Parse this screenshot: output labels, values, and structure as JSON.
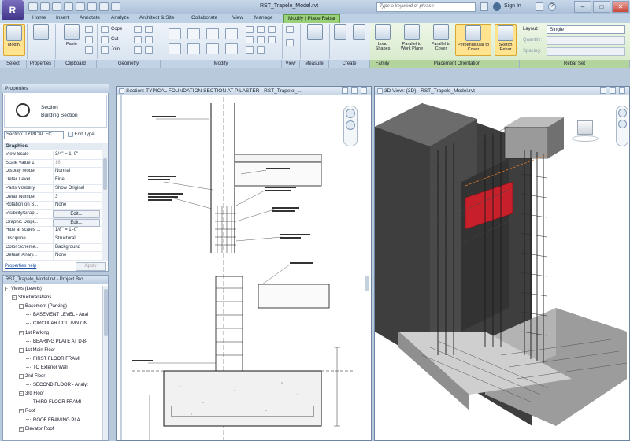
{
  "app": {
    "logo": "R",
    "title": "RST_Trapelo_Model.rvt",
    "search_placeholder": "Type a keyword or phrase",
    "user": "Sign In",
    "help": "?",
    "win_min": "–",
    "win_max": "□",
    "win_close": "✕"
  },
  "tabs": [
    "Home",
    "Insert",
    "Annotate",
    "Analyze",
    "Architect & Site",
    "Collaborate",
    "View",
    "Manage",
    "Modify | Place Rebar"
  ],
  "ribbon": {
    "modify": "Modify",
    "paste": "Paste",
    "copy": "Cope",
    "cut": "Cut",
    "join": "Join",
    "load_shapes": "Load Shapes",
    "parallel_work_plane": "Parallel to Work Plane",
    "parallel_cover": "Parallel to Cover",
    "perpendicular_cover": "Perpendicular to Cover",
    "sketch_rebar": "Sketch Rebar",
    "layout_lbl": "Layout:",
    "layout_val": "Single",
    "quantity_lbl": "Quantity:",
    "spacing_lbl": "Spacing:",
    "panels": {
      "select": "Select",
      "properties": "Properties",
      "clipboard": "Clipboard",
      "geometry": "Geometry",
      "modify": "Modify",
      "view": "View",
      "measure": "Measure",
      "create": "Create",
      "family": "Family",
      "placement": "Placement Orientation",
      "rebar_set": "Rebar Set"
    }
  },
  "properties": {
    "title": "Properties",
    "type_name": "Section",
    "type_sub": "Building Section",
    "type_selector": "Section: TYPICAL FC",
    "edit_type": "Edit Type",
    "group": "Graphics",
    "rows": [
      {
        "k": "View Scale",
        "v": "3/4\" = 1'-0\""
      },
      {
        "k": "Scale Value 1:",
        "v": "16"
      },
      {
        "k": "Display Model",
        "v": "Normal"
      },
      {
        "k": "Detail Level",
        "v": "Fine"
      },
      {
        "k": "Parts Visibility",
        "v": "Show Original"
      },
      {
        "k": "Detail Number",
        "v": "3"
      },
      {
        "k": "Rotation on S...",
        "v": "None"
      },
      {
        "k": "Visibility/Grap...",
        "v": "Edit..."
      },
      {
        "k": "Graphic Displ...",
        "v": "Edit..."
      },
      {
        "k": "Hide at scales ...",
        "v": "1/8\" = 1'-0\""
      },
      {
        "k": "Discipline",
        "v": "Structural"
      },
      {
        "k": "Color Scheme...",
        "v": "Background"
      },
      {
        "k": "Default Analy...",
        "v": "None"
      }
    ],
    "help": "Properties help",
    "apply": "Apply"
  },
  "project_browser": {
    "title": "RST_Trapelo_Model.rvt - Project Bro...",
    "items": [
      {
        "t": "Views (Levels)",
        "l": 0,
        "e": "-"
      },
      {
        "t": "Structural Plans",
        "l": 1,
        "e": "-"
      },
      {
        "t": "Basement (Parking)",
        "l": 2,
        "e": "-"
      },
      {
        "t": "BASEMENT LEVEL - Anal",
        "l": 3,
        "e": ""
      },
      {
        "t": "CIRCULAR COLUMN ON",
        "l": 3,
        "e": ""
      },
      {
        "t": "1st Parking",
        "l": 2,
        "e": "-"
      },
      {
        "t": "BEARING PLATE AT D-8-",
        "l": 3,
        "e": ""
      },
      {
        "t": "1st Main Floor",
        "l": 2,
        "e": "-"
      },
      {
        "t": "FIRST FLOOR FRAMI",
        "l": 3,
        "e": ""
      },
      {
        "t": "TO Exterior Wall",
        "l": 3,
        "e": ""
      },
      {
        "t": "2nd Floor",
        "l": 2,
        "e": "-"
      },
      {
        "t": "SECOND FLOOR - Analyt",
        "l": 3,
        "e": ""
      },
      {
        "t": "3rd Floor",
        "l": 2,
        "e": "-"
      },
      {
        "t": "THIRD FLOOR FRAMI",
        "l": 3,
        "e": ""
      },
      {
        "t": "Roof",
        "l": 2,
        "e": "-"
      },
      {
        "t": "ROOF FRAMING PLA",
        "l": 3,
        "e": ""
      },
      {
        "t": "Elevator Roof",
        "l": 2,
        "e": "-"
      }
    ]
  },
  "views": {
    "section_title": "Section: TYPICAL FOUNDATION SECTION AT PILASTER - RST_Trapelo_...",
    "view3d_title": "3D View: {3D} - RST_Trapelo_Model.rvt"
  },
  "colors": {
    "accent": "#c8202a",
    "ctx_tab": "#9ad07a",
    "rebar": "#5a5a5a"
  }
}
